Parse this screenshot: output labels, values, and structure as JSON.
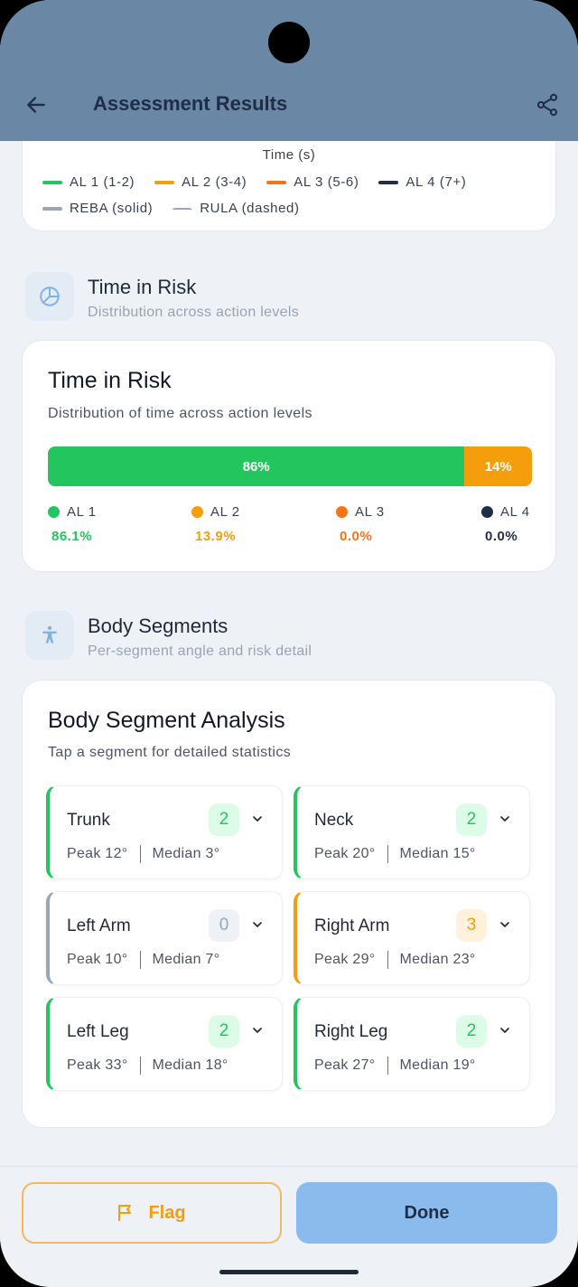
{
  "header": {
    "title": "Assessment Results",
    "back_icon": "arrow-left-icon",
    "share_icon": "share-icon"
  },
  "chart_legend": {
    "axis_title": "Time (s)",
    "levels": [
      {
        "label": "AL 1 (1-2)",
        "color": "#22c55e"
      },
      {
        "label": "AL 2 (3-4)",
        "color": "#f59e0b"
      },
      {
        "label": "AL 3 (5-6)",
        "color": "#f97316"
      },
      {
        "label": "AL 4 (7+)",
        "color": "#1f2d46"
      }
    ],
    "styles": [
      {
        "label": "REBA (solid)",
        "line": "solid",
        "color": "#9aa6b8"
      },
      {
        "label": "RULA (dashed)",
        "line": "dashed",
        "color": "#9aa6b8"
      }
    ]
  },
  "time_in_risk_section": {
    "icon": "pie-chart-icon",
    "title": "Time in Risk",
    "subtitle": "Distribution across action levels"
  },
  "time_in_risk_card": {
    "title": "Time in Risk",
    "subtitle": "Distribution of time across action levels",
    "bar": [
      {
        "label": "86%",
        "fraction": 0.861,
        "color": "#22c55e"
      },
      {
        "label": "14%",
        "fraction": 0.139,
        "color": "#f59e0b"
      }
    ],
    "levels": [
      {
        "label": "AL 1",
        "value": "86.1%",
        "color": "#22c55e"
      },
      {
        "label": "AL 2",
        "value": "13.9%",
        "color": "#f59e0b"
      },
      {
        "label": "AL 3",
        "value": "0.0%",
        "color": "#f97316"
      },
      {
        "label": "AL 4",
        "value": "0.0%",
        "color": "#1f2d46"
      }
    ]
  },
  "body_segments_section": {
    "icon": "accessibility-icon",
    "title": "Body Segments",
    "subtitle": "Per-segment angle and risk detail"
  },
  "segment_card": {
    "title": "Body Segment Analysis",
    "subtitle": "Tap a segment for detailed statistics",
    "segments": [
      {
        "name": "Trunk",
        "score": "2",
        "peak": "Peak 12°",
        "median": "Median 3°",
        "color": "#22c55e"
      },
      {
        "name": "Neck",
        "score": "2",
        "peak": "Peak 20°",
        "median": "Median 15°",
        "color": "#22c55e"
      },
      {
        "name": "Left Arm",
        "score": "0",
        "peak": "Peak 10°",
        "median": "Median 7°",
        "color": "#9aa6b8"
      },
      {
        "name": "Right Arm",
        "score": "3",
        "peak": "Peak 29°",
        "median": "Median 23°",
        "color": "#f59e0b"
      },
      {
        "name": "Left Leg",
        "score": "2",
        "peak": "Peak 33°",
        "median": "Median 18°",
        "color": "#22c55e"
      },
      {
        "name": "Right Leg",
        "score": "2",
        "peak": "Peak 27°",
        "median": "Median 19°",
        "color": "#22c55e"
      }
    ]
  },
  "actions": {
    "flag_label": "Flag",
    "flag_icon": "flag-icon",
    "done_label": "Done"
  }
}
